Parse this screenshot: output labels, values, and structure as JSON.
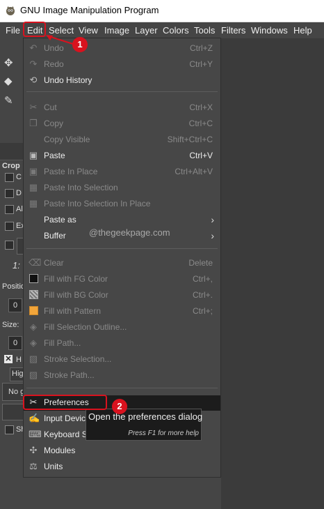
{
  "window": {
    "title": "GNU Image Manipulation Program"
  },
  "menubar": [
    "File",
    "Edit",
    "Select",
    "View",
    "Image",
    "Layer",
    "Colors",
    "Tools",
    "Filters",
    "Windows",
    "Help"
  ],
  "edit_menu": {
    "items": [
      {
        "label": "Undo",
        "shortcut": "Ctrl+Z",
        "icon": "undo-icon",
        "disabled": true
      },
      {
        "label": "Redo",
        "shortcut": "Ctrl+Y",
        "icon": "redo-icon",
        "disabled": true
      },
      {
        "label": "Undo History",
        "shortcut": "",
        "icon": "undo-history-icon",
        "disabled": false
      },
      {
        "label": "Cut",
        "shortcut": "Ctrl+X",
        "icon": "scissors-icon",
        "disabled": true
      },
      {
        "label": "Copy",
        "shortcut": "Ctrl+C",
        "icon": "copy-icon",
        "disabled": true
      },
      {
        "label": "Copy Visible",
        "shortcut": "Shift+Ctrl+C",
        "icon": "",
        "disabled": true
      },
      {
        "label": "Paste",
        "shortcut": "Ctrl+V",
        "icon": "paste-icon",
        "disabled": false
      },
      {
        "label": "Paste In Place",
        "shortcut": "Ctrl+Alt+V",
        "icon": "paste-in-place-icon",
        "disabled": true
      },
      {
        "label": "Paste Into Selection",
        "shortcut": "",
        "icon": "paste-into-selection-icon",
        "disabled": true
      },
      {
        "label": "Paste Into Selection In Place",
        "shortcut": "",
        "icon": "paste-into-selection-in-place-icon",
        "disabled": true
      },
      {
        "label": "Paste as",
        "shortcut": "",
        "icon": "",
        "disabled": false,
        "submenu": true
      },
      {
        "label": "Buffer",
        "shortcut": "",
        "icon": "",
        "disabled": false,
        "submenu": true
      },
      {
        "label": "Clear",
        "shortcut": "Delete",
        "icon": "clear-icon",
        "disabled": true
      },
      {
        "label": "Fill with FG Color",
        "shortcut": "Ctrl+,",
        "icon": "fg-color-swatch-icon",
        "disabled": true
      },
      {
        "label": "Fill with BG Color",
        "shortcut": "Ctrl+.",
        "icon": "bg-color-swatch-icon",
        "disabled": true
      },
      {
        "label": "Fill with Pattern",
        "shortcut": "Ctrl+;",
        "icon": "pattern-swatch-icon",
        "disabled": true
      },
      {
        "label": "Fill Selection Outline...",
        "shortcut": "",
        "icon": "fill-outline-icon",
        "disabled": true
      },
      {
        "label": "Fill Path...",
        "shortcut": "",
        "icon": "fill-path-icon",
        "disabled": true
      },
      {
        "label": "Stroke Selection...",
        "shortcut": "",
        "icon": "stroke-selection-icon",
        "disabled": true
      },
      {
        "label": "Stroke Path...",
        "shortcut": "",
        "icon": "stroke-path-icon",
        "disabled": true
      },
      {
        "label": "Preferences",
        "shortcut": "",
        "icon": "preferences-icon",
        "disabled": false,
        "highlighted": true
      },
      {
        "label": "Input Devic",
        "shortcut": "",
        "icon": "input-devices-icon",
        "disabled": false
      },
      {
        "label": "Keyboard S",
        "shortcut": "",
        "icon": "keyboard-icon",
        "disabled": false
      },
      {
        "label": "Modules",
        "shortcut": "",
        "icon": "modules-icon",
        "disabled": false
      },
      {
        "label": "Units",
        "shortcut": "",
        "icon": "units-icon",
        "disabled": false
      }
    ]
  },
  "watermark": "@thegeekpage.com",
  "tooltip": {
    "text": "Open the preferences dialog",
    "hint": "Press F1 for more help"
  },
  "annotations": {
    "step1": "1",
    "step2": "2"
  },
  "left_panel": {
    "crop_label": "Crop",
    "option_letters": [
      "C",
      "D",
      "Al",
      "Ex"
    ],
    "ratio": "1:",
    "position_label": "Positio",
    "position_value": "0",
    "size_label": "Size:",
    "size_value": "0",
    "highlight_letter": "H",
    "dropdown_hi": "Hig",
    "dropdown_no": "No g",
    "last_letter": "Sh"
  },
  "colors": {
    "accent_red": "#d9121e",
    "menu_bg": "#474747",
    "highlight": "#1c1c1c"
  }
}
